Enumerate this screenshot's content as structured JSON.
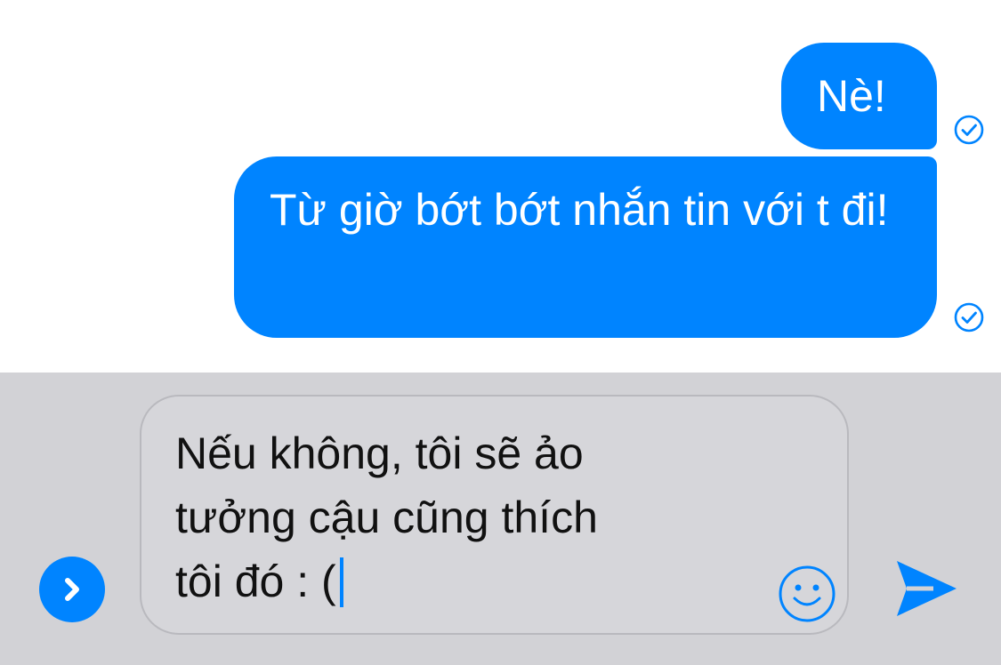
{
  "messages": [
    {
      "text": "Nè!",
      "status_icon": "read-check-icon"
    },
    {
      "text": "Từ giờ bớt bớt nhắn tin với t đi!",
      "status_icon": "read-check-icon"
    }
  ],
  "composer": {
    "draft_text": "Nếu không, tôi sẽ ảo\ntưởng cậu cũng thích\ntôi đó : (",
    "expand_icon": "chevron-right-icon",
    "emoji_icon": "smiley-icon",
    "send_icon": "send-icon"
  },
  "colors": {
    "accent": "#0084ff",
    "chat_background": "#ffffff",
    "composer_background": "#d2d2d6",
    "input_background": "#d6d6da",
    "input_border": "#b9b9be",
    "bubble_text": "#ffffff",
    "draft_text": "#111111"
  }
}
